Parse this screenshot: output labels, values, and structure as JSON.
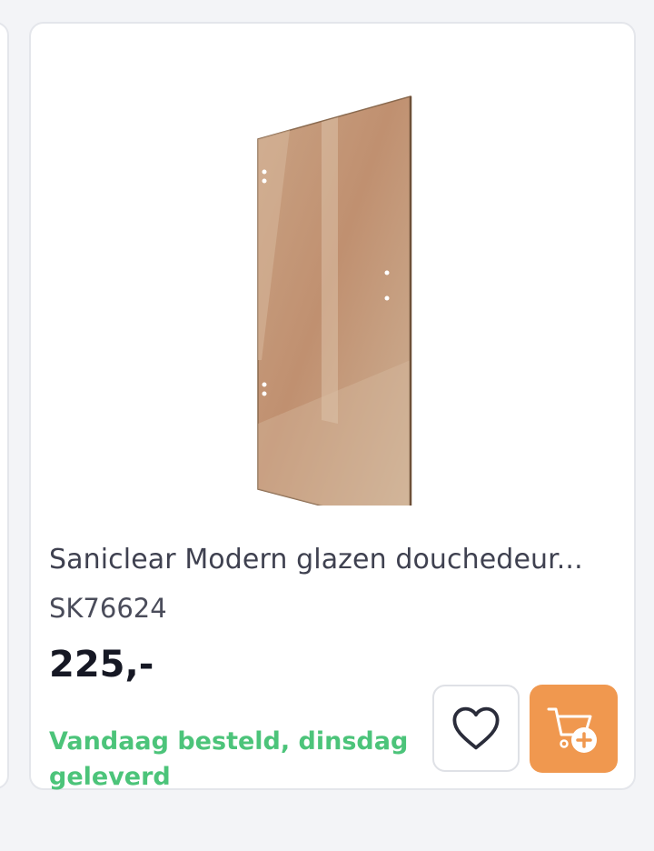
{
  "product": {
    "title": "Saniclear Modern glazen douchedeur...",
    "sku": "SK76624",
    "price": "225,-",
    "delivery": "Vandaag besteld, dinsdag geleverd",
    "image_icon": "bronze-glass-shower-door-image"
  },
  "actions": {
    "wishlist_icon": "heart-icon",
    "cart_icon": "cart-add-icon"
  },
  "colors": {
    "price": "#161824",
    "delivery": "#4cc47a",
    "cart_button": "#f0984f",
    "glass": "#c69a76"
  }
}
